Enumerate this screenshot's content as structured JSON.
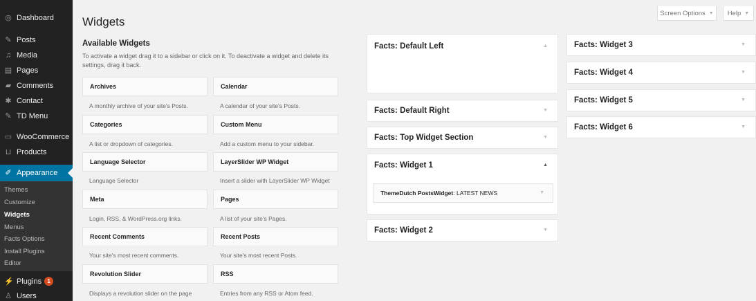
{
  "sidebar": {
    "items": [
      {
        "label": "Dashboard",
        "icon": "dashboard-icon"
      },
      {
        "label": "Posts",
        "icon": "pin-icon"
      },
      {
        "label": "Media",
        "icon": "media-icon"
      },
      {
        "label": "Pages",
        "icon": "pages-icon"
      },
      {
        "label": "Comments",
        "icon": "comments-icon"
      },
      {
        "label": "Contact",
        "icon": "gear-icon"
      },
      {
        "label": "TD Menu",
        "icon": "pin-icon"
      },
      {
        "label": "WooCommerce",
        "icon": "woocommerce-icon"
      },
      {
        "label": "Products",
        "icon": "cart-icon"
      },
      {
        "label": "Appearance",
        "icon": "brush-icon"
      },
      {
        "label": "Plugins",
        "icon": "plug-icon",
        "badge": "1"
      },
      {
        "label": "Users",
        "icon": "users-icon"
      }
    ],
    "submenu": [
      "Themes",
      "Customize",
      "Widgets",
      "Menus",
      "Facts Options",
      "Install Plugins",
      "Editor"
    ],
    "active_color": "#0074a2"
  },
  "header": {
    "title": "Widgets",
    "screen_options": "Screen Options",
    "help": "Help"
  },
  "available": {
    "title": "Available Widgets",
    "description": "To activate a widget drag it to a sidebar or click on it. To deactivate a widget and delete its settings, drag it back.",
    "widgets": [
      {
        "name": "Archives",
        "desc": "A monthly archive of your site's Posts."
      },
      {
        "name": "Calendar",
        "desc": "A calendar of your site's Posts."
      },
      {
        "name": "Categories",
        "desc": "A list or dropdown of categories."
      },
      {
        "name": "Custom Menu",
        "desc": "Add a custom menu to your sidebar."
      },
      {
        "name": "Language Selector",
        "desc": "Language Selector"
      },
      {
        "name": "LayerSlider WP Widget",
        "desc": "Insert a slider with LayerSlider WP Widget"
      },
      {
        "name": "Meta",
        "desc": "Login, RSS, & WordPress.org links."
      },
      {
        "name": "Pages",
        "desc": "A list of your site's Pages."
      },
      {
        "name": "Recent Comments",
        "desc": "Your site's most recent comments."
      },
      {
        "name": "Recent Posts",
        "desc": "Your site's most recent Posts."
      },
      {
        "name": "Revolution Slider",
        "desc": "Displays a revolution slider on the page"
      },
      {
        "name": "RSS",
        "desc": "Entries from any RSS or Atom feed."
      }
    ]
  },
  "areas": {
    "default_left": "Facts: Default Left",
    "default_right": "Facts: Default Right",
    "top_widget_section": "Facts: Top Widget Section",
    "widget_1": "Facts: Widget 1",
    "widget_1_item_name": "ThemeDutch PostsWidget",
    "widget_1_item_title": ": LATEST NEWS",
    "widget_2": "Facts: Widget 2",
    "widget_3": "Facts: Widget 3",
    "widget_4": "Facts: Widget 4",
    "widget_5": "Facts: Widget 5",
    "widget_6": "Facts: Widget 6"
  }
}
